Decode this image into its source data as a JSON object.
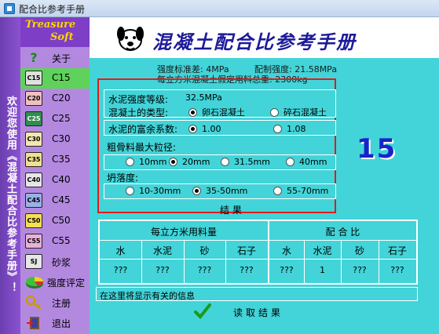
{
  "window": {
    "title": "配合比参考手册"
  },
  "left_strip": {
    "text": "欢迎您使用《混凝土配合比参考手册》！"
  },
  "logo": {
    "line1": "Treasure",
    "line2": "Soft"
  },
  "sidebar": {
    "items": [
      {
        "icon": "?",
        "label": "关于"
      },
      {
        "icon": "C15",
        "label": "C15"
      },
      {
        "icon": "C20",
        "label": "C20"
      },
      {
        "icon": "C25",
        "label": "C25"
      },
      {
        "icon": "C30",
        "label": "C30"
      },
      {
        "icon": "C35",
        "label": "C35"
      },
      {
        "icon": "C40",
        "label": "C40"
      },
      {
        "icon": "C45",
        "label": "C45"
      },
      {
        "icon": "C50",
        "label": "C50"
      },
      {
        "icon": "C55",
        "label": "C55"
      },
      {
        "icon": "SJ",
        "label": "砂浆"
      },
      {
        "icon": "pie",
        "label": "强度评定"
      },
      {
        "icon": "key",
        "label": "注册"
      },
      {
        "icon": "exit",
        "label": "退出"
      }
    ],
    "selected": "C15"
  },
  "header": {
    "title": "混凝土配合比参考手册"
  },
  "info": {
    "std_strength": "强度标准差: 4MPa",
    "mix_strength": "配制强度: 21.58MPa",
    "assumed_weight": "每立方米混凝土假定用料总重: 2300kg"
  },
  "params": {
    "cement_grade_label": "水泥强度等级:",
    "cement_grade_value": "32.5MPa",
    "type_label": "混凝土的类型:",
    "type_options": [
      "卵石混凝土",
      "碎石混凝土"
    ],
    "type_selected": 0,
    "rich_label": "水泥的富余系数:",
    "rich_options": [
      "1.00",
      "1.08"
    ],
    "rich_selected": 0,
    "agg_label": "粗骨料最大粒径:",
    "agg_options": [
      "10mm",
      "20mm",
      "31.5mm",
      "40mm"
    ],
    "agg_selected": 1,
    "slump_label": "坍落度:",
    "slump_options": [
      "10-30mm",
      "35-50mm",
      "55-70mm"
    ],
    "slump_selected": 1
  },
  "grade_display": "15",
  "result": {
    "label": "结 果",
    "group_left": "每立方米用料量",
    "group_right": "配 合 比",
    "columns_left": [
      "水",
      "水泥",
      "砂",
      "石子"
    ],
    "columns_right": [
      "水",
      "水泥",
      "砂",
      "石子"
    ],
    "values_left": [
      "???",
      "???",
      "???",
      "???"
    ],
    "values_right": [
      "???",
      "1",
      "???",
      "???"
    ]
  },
  "status": {
    "text": "在这里将显示有关的信息"
  },
  "read_button": {
    "label": "读取结果"
  },
  "colors": {
    "sidebar": "#b389e0",
    "main_bg": "#42d4d8",
    "selected": "#5fd25b",
    "title": "#1d1a9a",
    "bignum": "#1624c8"
  }
}
